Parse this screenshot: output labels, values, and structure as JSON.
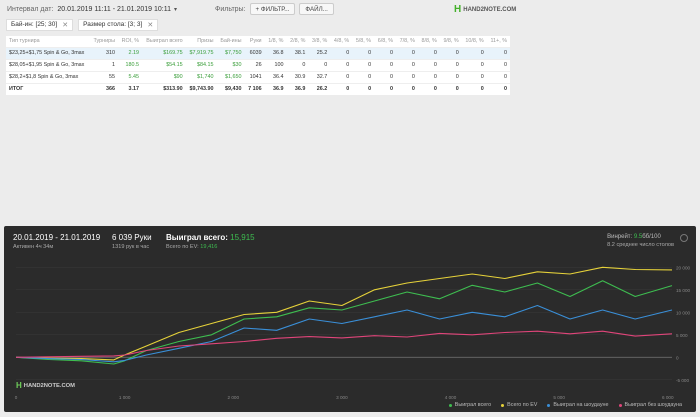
{
  "topbar": {
    "interval_label": "Интервал дат:",
    "interval_value": "20.01.2019 11:11 - 21.01.2019 10:11",
    "filters_label": "Фильтры:",
    "filter_button": "+ ФИЛЬТР...",
    "file_button": "ФАЙЛ..."
  },
  "brand": "HAND2NOTE.COM",
  "chips": [
    {
      "label": "Бай-ин: [25; 30]"
    },
    {
      "label": "Размер стола: [3; 3]"
    }
  ],
  "table": {
    "headers": [
      "Тип турнира",
      "Турниры",
      "ROI, %",
      "Выиграл всего",
      "Призы",
      "Бай-ины",
      "Руки",
      "1/8, %",
      "2/8, %",
      "3/8, %",
      "4/8, %",
      "5/8, %",
      "6/8, %",
      "7/8, %",
      "8/8, %",
      "9/8, %",
      "10/8, %",
      "11+, %"
    ],
    "rows": [
      {
        "cells": [
          "$23,25+$1,75 Spin & Go, 3max",
          "310",
          "2.19",
          "$169.75",
          "$7,919.75",
          "$7,750",
          "6039",
          "36.8",
          "38.1",
          "25.2",
          "0",
          "0",
          "0",
          "0",
          "0",
          "0",
          "0",
          "0"
        ]
      },
      {
        "cells": [
          "$28,05+$1,95 Spin & Go, 3max",
          "1",
          "180.5",
          "$54.15",
          "$84.15",
          "$30",
          "26",
          "100",
          "0",
          "0",
          "0",
          "0",
          "0",
          "0",
          "0",
          "0",
          "0",
          "0"
        ]
      },
      {
        "cells": [
          "$28,2+$1,8 Spin & Go, 3max",
          "55",
          "5.45",
          "$90",
          "$1,740",
          "$1,650",
          "1041",
          "36.4",
          "30.9",
          "32.7",
          "0",
          "0",
          "0",
          "0",
          "0",
          "0",
          "0",
          "0"
        ]
      }
    ],
    "total": {
      "cells": [
        "ИТОГ",
        "366",
        "3.17",
        "$313.90",
        "$9,743.90",
        "$9,430",
        "7 106",
        "36.9",
        "36.9",
        "26.2",
        "0",
        "0",
        "0",
        "0",
        "0",
        "0",
        "0",
        "0"
      ]
    }
  },
  "chart_header": {
    "dates": "20.01.2019 - 21.01.2019",
    "active": "Активен 4ч 34м",
    "hands": "6 039 Руки",
    "per_hour": "1319 рук в час",
    "won_label": "Выиграл всего:",
    "won_value": "15,915",
    "ev_label": "Всего по EV:",
    "ev_value": "19,416",
    "winrate_label": "Винрейт:",
    "winrate_value": "9.5",
    "winrate_unit": "бб/100",
    "tables_avg": "8.2 среднее число столов"
  },
  "chart_data": {
    "type": "line",
    "x_ticks": [
      "0",
      "1 000",
      "2 000",
      "3 000",
      "4 000",
      "5 000",
      "6 000"
    ],
    "y_ticks": [
      "20 000",
      "15 000",
      "10 000",
      "5 000",
      "0",
      "-5 000"
    ],
    "xlim": [
      0,
      6039
    ],
    "ylim": [
      -7500,
      22500
    ],
    "series": [
      {
        "name": "Выиграл всего",
        "color": "#3ebd50",
        "x": [
          0,
          300,
          600,
          900,
          1000,
          1200,
          1500,
          1800,
          2100,
          2400,
          2700,
          3000,
          3300,
          3600,
          3900,
          4200,
          4500,
          4800,
          5100,
          5400,
          5700,
          6039
        ],
        "y": [
          0,
          -500,
          -800,
          -1500,
          -800,
          1500,
          3500,
          5000,
          8500,
          9000,
          11000,
          10500,
          12500,
          14500,
          13000,
          16000,
          14500,
          16500,
          13500,
          17000,
          13500,
          15915
        ]
      },
      {
        "name": "Всего по EV",
        "color": "#e6d23a",
        "x": [
          0,
          300,
          600,
          900,
          1000,
          1200,
          1500,
          1800,
          2100,
          2400,
          2700,
          3000,
          3300,
          3600,
          3900,
          4200,
          4500,
          4800,
          5100,
          5400,
          5700,
          6039
        ],
        "y": [
          0,
          -200,
          -300,
          -600,
          500,
          2500,
          5500,
          7500,
          9500,
          10000,
          12500,
          11500,
          15000,
          16500,
          17500,
          18500,
          17500,
          19000,
          18500,
          20000,
          19500,
          19416
        ]
      },
      {
        "name": "Выиграл на шоудауне",
        "color": "#3a8fd8",
        "x": [
          0,
          300,
          600,
          900,
          1000,
          1200,
          1500,
          1800,
          2100,
          2400,
          2700,
          3000,
          3300,
          3600,
          3900,
          4200,
          4500,
          4800,
          5100,
          5400,
          5700,
          6039
        ],
        "y": [
          0,
          -300,
          -500,
          -1000,
          -700,
          500,
          2000,
          3500,
          6500,
          6000,
          8500,
          7500,
          9000,
          10500,
          8500,
          10000,
          9000,
          11500,
          8500,
          10500,
          8500,
          10500
        ]
      },
      {
        "name": "Выиграл без шоудауна",
        "color": "#e0457a",
        "x": [
          0,
          300,
          600,
          900,
          1000,
          1200,
          1500,
          1800,
          2100,
          2400,
          2700,
          3000,
          3300,
          3600,
          3900,
          4200,
          4500,
          4800,
          5100,
          5400,
          5700,
          6039
        ],
        "y": [
          0,
          100,
          200,
          300,
          500,
          1500,
          2500,
          3000,
          3500,
          4200,
          4600,
          4300,
          4800,
          4500,
          5300,
          5000,
          5500,
          5800,
          5200,
          5800,
          4700,
          5200
        ]
      }
    ]
  }
}
